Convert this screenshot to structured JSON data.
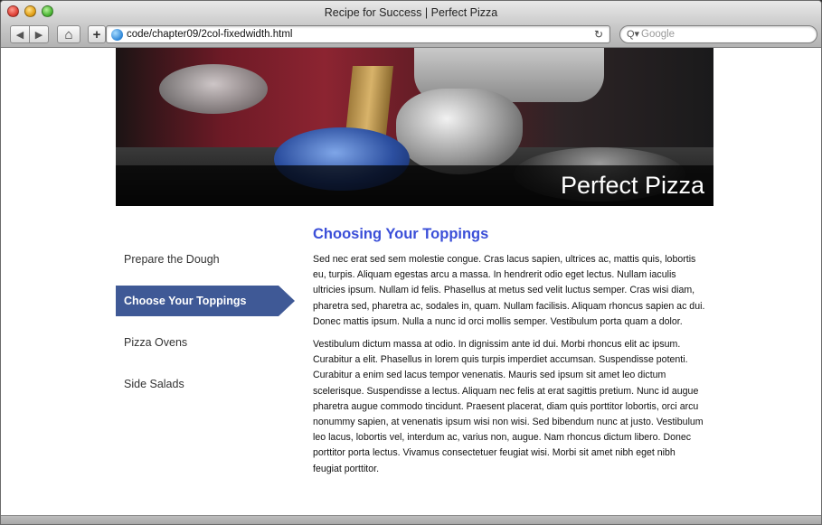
{
  "window": {
    "title": "Recipe for Success | Perfect Pizza"
  },
  "toolbar": {
    "back_icon": "◀",
    "forward_icon": "▶",
    "home_icon": "⌂",
    "add_icon": "+",
    "url": "code/chapter09/2col-fixedwidth.html",
    "reload_icon": "↻",
    "search_icon": "Q▾",
    "search_placeholder": "Google"
  },
  "banner": {
    "site_title": "Perfect Pizza"
  },
  "sidebar": {
    "items": [
      {
        "label": "Prepare the Dough",
        "active": false
      },
      {
        "label": "Choose Your Toppings",
        "active": true
      },
      {
        "label": "Pizza Ovens",
        "active": false
      },
      {
        "label": "Side Salads",
        "active": false
      }
    ]
  },
  "main": {
    "heading": "Choosing Your Toppings",
    "paragraphs": [
      "Sed nec erat sed sem molestie congue. Cras lacus sapien, ultrices ac, mattis quis, lobortis eu, turpis. Aliquam egestas arcu a massa. In hendrerit odio eget lectus. Nullam iaculis ultricies ipsum. Nullam id felis. Phasellus at metus sed velit luctus semper. Cras wisi diam, pharetra sed, pharetra ac, sodales in, quam. Nullam facilisis. Aliquam rhoncus sapien ac dui. Donec mattis ipsum. Nulla a nunc id orci mollis semper. Vestibulum porta quam a dolor.",
      "Vestibulum dictum massa at odio. In dignissim ante id dui. Morbi rhoncus elit ac ipsum. Curabitur a elit. Phasellus in lorem quis turpis imperdiet accumsan. Suspendisse potenti. Curabitur a enim sed lacus tempor venenatis. Mauris sed ipsum sit amet leo dictum scelerisque. Suspendisse a lectus. Aliquam nec felis at erat sagittis pretium. Nunc id augue pharetra augue commodo tincidunt. Praesent placerat, diam quis porttitor lobortis, orci arcu nonummy sapien, at venenatis ipsum wisi non wisi. Sed bibendum nunc at justo. Vestibulum leo lacus, lobortis vel, interdum ac, varius non, augue. Nam rhoncus dictum libero. Donec porttitor porta lectus. Vivamus consectetuer feugiat wisi. Morbi sit amet nibh eget nibh feugiat porttitor."
    ]
  },
  "colors": {
    "accent": "#3f5996",
    "heading": "#3b4fd8"
  }
}
